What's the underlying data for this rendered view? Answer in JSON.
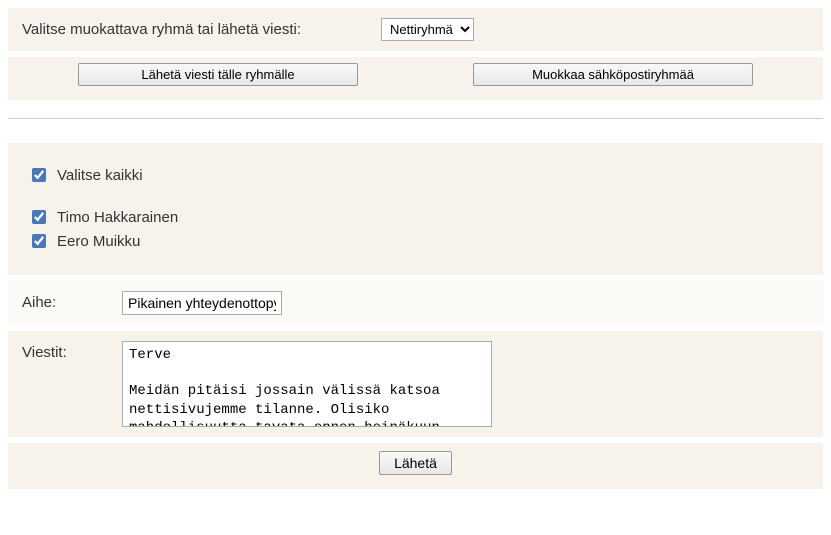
{
  "header": {
    "label": "Valitse muokattava ryhmä tai lähetä viesti:",
    "selected_group": "Nettiryhmä"
  },
  "actions": {
    "send_to_group": "Lähetä viesti tälle ryhmälle",
    "edit_group": "Muokkaa sähköpostiryhmää"
  },
  "recipients": {
    "select_all_label": "Valitse kaikki",
    "select_all_checked": true,
    "items": [
      {
        "name": "Timo Hakkarainen",
        "checked": true
      },
      {
        "name": "Eero Muikku",
        "checked": true
      }
    ]
  },
  "subject": {
    "label": "Aihe:",
    "value": "Pikainen yhteydenottopyyntö"
  },
  "message": {
    "label": "Viestit:",
    "value": "Terve\n\nMeidän pitäisi jossain välissä katsoa nettisivujemme tilanne. Olisiko mahdollisuutta tavata ennen heinäkuun alkua?"
  },
  "send_label": "Lähetä"
}
